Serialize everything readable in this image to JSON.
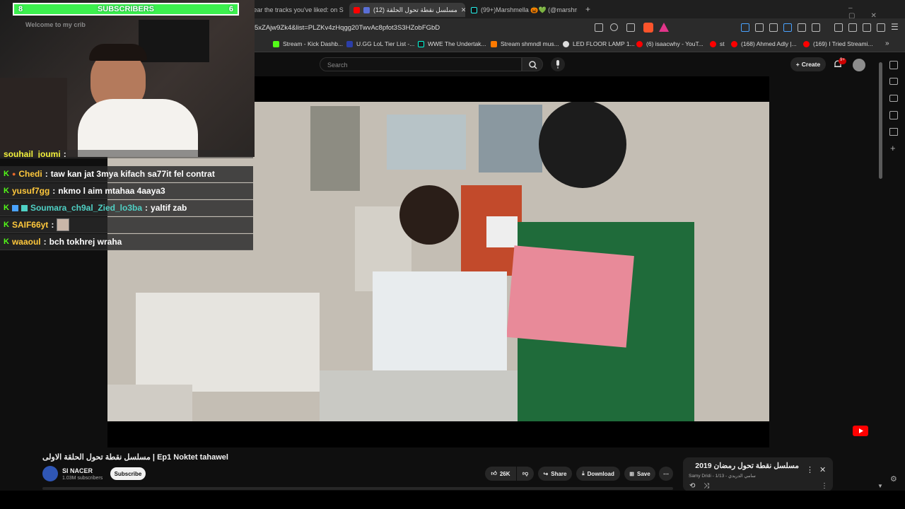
{
  "tabs": [
    {
      "label": "Hear the tracks you've liked: on Sou",
      "icon": "soundcloud-icon"
    },
    {
      "label": "(12) مسلسل نقطة تحول الحلقة",
      "icon": "youtube-icon"
    },
    {
      "label": "(99+)Marshmella 🎃💚 (@marshme",
      "icon": "tiktok-icon"
    }
  ],
  "url": "5xZAjw9Zk4&list=PLZKv4zHqgg20TwvAc8pfot3S3HZobFGbD",
  "bookmarks": [
    "Stream - Kick Dashb...",
    "U.GG LoL Tier List -...",
    "WWE The Undertak...",
    "Stream shmndl mus...",
    "LED FLOOR LAMP 1...",
    "(6) isaacwhy - YouT...",
    "st",
    "(168) Ahmed Adly |...",
    "(169) I Tried Streami..."
  ],
  "subscriber_bar": {
    "left": "8",
    "label": "SUBSCRIBERS",
    "right": "6"
  },
  "webcam": {
    "sign": "Welcome to my crib"
  },
  "chat": [
    {
      "user": "souhail_joumi",
      "msg": "",
      "color": "#f2f23c"
    },
    {
      "user": "Chedi",
      "msg": "taw kan jat 3mya kifach sa77it fel contrat",
      "color": "#ffc83c"
    },
    {
      "user": "yusuf7gg",
      "msg": "nkmo l aim mtahaa 4aaya3",
      "color": "#ffc83c"
    },
    {
      "user": "Soumara_ch9al_Zied_lo3ba",
      "msg": "yaltif zab",
      "color": "#4fd1c5"
    },
    {
      "user": "SAIF66yt",
      "msg": "",
      "color": "#ffc83c"
    },
    {
      "user": "waaoul",
      "msg": "bch tokhrej wraha",
      "color": "#ffc83c"
    }
  ],
  "youtube": {
    "search_placeholder": "Search",
    "create_label": "Create",
    "notification_badge": "9+",
    "video_title": "مسلسل نقطة تحول الحلقة الاولى | Ep1 Noktet tahawel",
    "channel_name": "SI NACER",
    "channel_subs": "1.03M subscribers",
    "subscribe_label": "Subscribe",
    "like_count": "26K",
    "share_label": "Share",
    "download_label": "Download",
    "save_label": "Save",
    "playlist_title": "مسلسل نقطة تحول رمضان 2019",
    "playlist_meta": "Samy Dridi - سامي الدريدي - 1/13"
  },
  "colors": {
    "kick_green": "#53fc18",
    "yt_red": "#ff0000",
    "sub_green": "#3cf04e"
  }
}
